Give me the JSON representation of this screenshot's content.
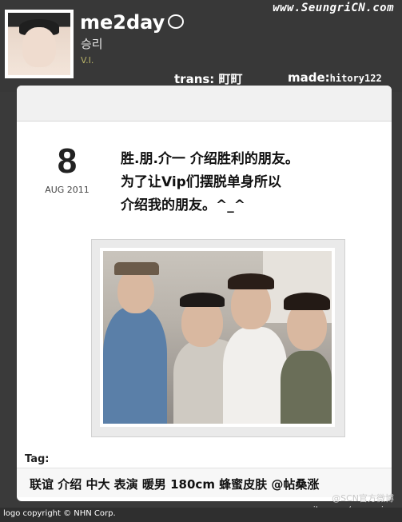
{
  "header": {
    "brand": "me2day",
    "username": "승리",
    "role": "V.I.",
    "site_url": "www.SeungriCN.com",
    "trans_label": "trans:",
    "trans_value": "町町",
    "made_label": "made:",
    "made_value": "hitory122"
  },
  "post": {
    "date_day": "8",
    "date_month": "AUG 2011",
    "lines": [
      "胜.朋.介一 介绍胜利的朋友。",
      "为了让Vip们摆脱单身所以",
      "介绍我的朋友。^_^"
    ]
  },
  "tags": {
    "label": "Tag:",
    "text": "联谊 介绍 中大 表演 暖男 180cm 蜂蜜皮肤 @帖桑涨"
  },
  "footer": {
    "copyright": "logo copyright © NHN Corp.",
    "watermark_line1": "@SCN官方微博",
    "watermark_line2": "weibo.com/seungricn"
  }
}
